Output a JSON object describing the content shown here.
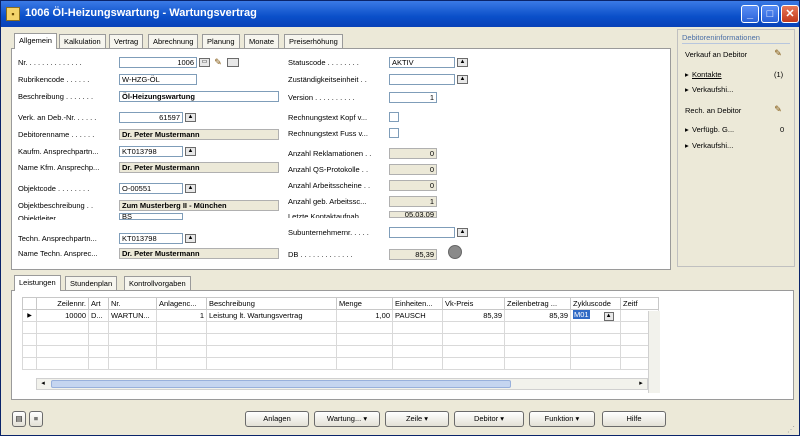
{
  "window": {
    "title": "1006 Öl-Heizungswartung - Wartungsvertrag"
  },
  "tabs": [
    "Allgemein",
    "Kalkulation",
    "Vertrag",
    "Abrechnung",
    "Planung",
    "Monate",
    "Preiserhöhung"
  ],
  "general": {
    "nr": {
      "label": "Nr. . . . . . . . . . . . . .",
      "value": "1006"
    },
    "rubrikencode": {
      "label": "Rubrikencode . . . . . .",
      "value": "W-HZG-ÖL"
    },
    "beschreibung": {
      "label": "Beschreibung . . . . . . .",
      "value": "Öl-Heizungswartung"
    },
    "verk_an_deb": {
      "label": "Verk. an Deb.-Nr. . . . . .",
      "value": "61597"
    },
    "debitorenname": {
      "label": "Debitorenname . . . . . .",
      "value": "Dr. Peter Mustermann"
    },
    "kaufm_ansprech": {
      "label": "Kaufm. Ansprechpartn...",
      "value": "KT013798"
    },
    "name_kfm": {
      "label": "Name Kfm. Ansprechp...",
      "value": "Dr. Peter Mustermann"
    },
    "objektcode": {
      "label": "Objektcode . . . . . . . .",
      "value": "O-00551"
    },
    "objektbeschreibung": {
      "label": "Objektbeschreibung . .",
      "value": "Zum Musterberg II - München"
    },
    "objektleiter": {
      "label": "Objektleiter",
      "value": "BS"
    },
    "techn_ansprech": {
      "label": "Techn. Ansprechpartn...",
      "value": "KT013798"
    },
    "name_techn": {
      "label": "Name Techn. Ansprec...",
      "value": "Dr. Peter Mustermann"
    },
    "statuscode": {
      "label": "Statuscode . . . . . . . .",
      "value": "AKTIV"
    },
    "zustaendigkeit": {
      "label": "Zuständigkeitseinheit . .",
      "value": ""
    },
    "version": {
      "label": "Version . . . . . . . . . .",
      "value": "1"
    },
    "rt_kopf": {
      "label": "Rechnungstext Kopf v..."
    },
    "rt_fuss": {
      "label": "Rechnungstext Fuss v..."
    },
    "reklamationen": {
      "label": "Anzahl Reklamationen . .",
      "value": "0"
    },
    "qs_protokolle": {
      "label": "Anzahl QS-Protokolle . .",
      "value": "0"
    },
    "arbeitsscheine": {
      "label": "Anzahl Arbeitsscheine . .",
      "value": "0"
    },
    "geb_arbeitssc": {
      "label": "Anzahl geb. Arbeitssc...",
      "value": "1"
    },
    "letzte_kontakt": {
      "label": "Letzte Kontaktaufnah...",
      "value": "05.03.09"
    },
    "subunternehmer": {
      "label": "Subunternehmernr. . . . .",
      "value": ""
    },
    "db": {
      "label": "DB . . . . . . . . . . . . .",
      "value": "85,39"
    }
  },
  "factbox": {
    "title": "Debitoreninformationen",
    "verkauf_heading": "Verkauf an Debitor",
    "kontakte_label": "Kontakte",
    "kontakte_count": "(1)",
    "verkaufshi_1": "Verkaufshi...",
    "rech_heading": "Rech. an Debitor",
    "verfuegb_label": "Verfügb. G...",
    "verfuegb_value": "0",
    "verkaufshi_2": "Verkaufshi..."
  },
  "lines_tabs": [
    "Leistungen",
    "Stundenplan",
    "Kontrollvorgaben"
  ],
  "lines": {
    "columns": [
      "Zeilennr.",
      "Art",
      "Nr.",
      "Anlagenc...",
      "Beschreibung",
      "Menge",
      "Einheiten...",
      "Vk-Preis",
      "Zeilenbetrag ...",
      "Zykluscode",
      "Zeitf"
    ],
    "rows": [
      [
        "10000",
        "D...",
        "WARTUN...",
        "1",
        "Leistung lt. Wartungsvertrag",
        "1,00",
        "PAUSCH",
        "85,39",
        "85,39",
        "M01",
        ""
      ]
    ]
  },
  "buttons": {
    "anlagen": "Anlagen",
    "wartung": "Wartung...",
    "zeile": "Zeile",
    "debitor": "Debitor",
    "funktion": "Funktion",
    "hilfe": "Hilfe"
  }
}
